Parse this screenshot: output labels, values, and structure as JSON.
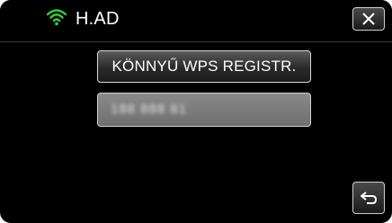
{
  "header": {
    "network_name": "H.AD",
    "wifi_icon": "wifi-icon",
    "close_icon": "close-icon"
  },
  "main": {
    "wps_button_label": "KÖNNYŰ WPS REGISTR.",
    "pin_value": "188 888 81"
  },
  "footer": {
    "back_icon": "back-arrow-icon"
  },
  "colors": {
    "accent": "#2fd13a",
    "background": "#000000"
  }
}
